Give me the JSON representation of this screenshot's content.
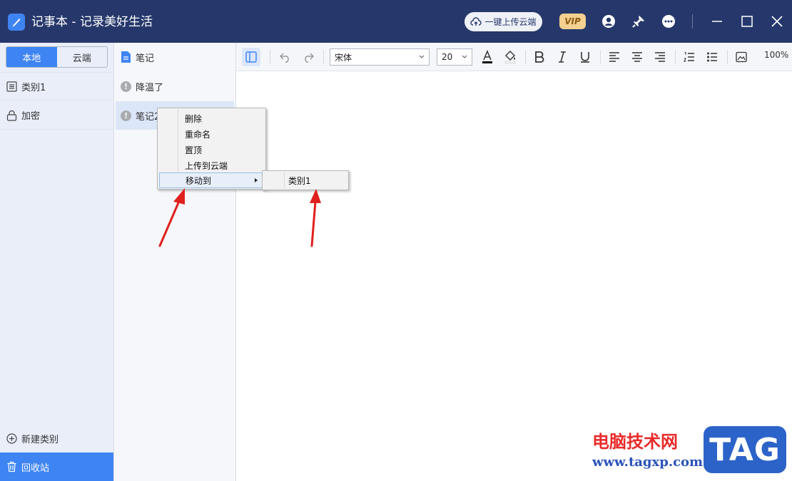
{
  "app": {
    "title": "记事本 - 记录美好生活",
    "upload_button": "一键上传云端",
    "vip_label": "VIP"
  },
  "sidebar": {
    "tabs": [
      {
        "label": "本地",
        "active": true
      },
      {
        "label": "云端",
        "active": false
      }
    ],
    "categories": [
      {
        "label": "类别1",
        "icon": "list-icon"
      },
      {
        "label": "加密",
        "icon": "lock-icon"
      }
    ],
    "new_category": "新建类别",
    "recycle_bin": "回收站"
  },
  "notes": {
    "header": "笔记",
    "items": [
      {
        "title": "降温了",
        "selected": false
      },
      {
        "title": "笔记2",
        "selected": true
      }
    ]
  },
  "toolbar": {
    "font_family": "宋体",
    "font_size": "20",
    "zoom": "100%"
  },
  "context_menu": {
    "items": [
      "删除",
      "重命名",
      "置顶",
      "上传到云端",
      "移动到"
    ],
    "hover_index": 4,
    "submenu": [
      "类别1"
    ]
  },
  "watermark": {
    "brand_cn": "电脑技术网",
    "url": "www.tagxp.com",
    "logo": "TAG"
  },
  "colors": {
    "titlebar": "#26386b",
    "accent": "#3f84f3",
    "annotation_arrow": "#e0201c"
  }
}
